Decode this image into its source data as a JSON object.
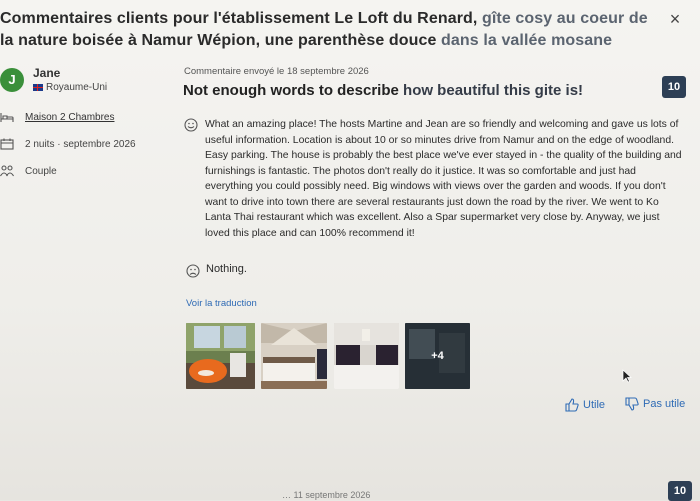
{
  "header": {
    "title_line1_main": "Commentaires clients pour l'établissement Le Loft du Renard,",
    "title_line1_muted": " gîte cosy au coeur de",
    "title_line2_main": "la nature boisée à Namur Wépion, une parenthèse douce",
    "title_line2_muted": " dans la vallée mosane",
    "close_icon": "×"
  },
  "reviewer": {
    "initial": "J",
    "name": "Jane",
    "country": "Royaume-Uni",
    "room": "Maison 2 Chambres",
    "stay": "2 nuits · septembre 2026",
    "traveler_type": "Couple"
  },
  "review": {
    "date": "Commentaire envoyé le 18 septembre 2026",
    "title_main": "Not enough words to describe",
    "title_tail": " how beautiful this gite is!",
    "score": "10",
    "positive": "What an amazing place! The hosts Martine and Jean are so friendly and welcoming and gave us lots of useful information. Location is about 10 or so minutes drive from Namur and on the edge of woodland. Easy parking. The house is probably the best place we've ever stayed in - the quality of the building and furnishings is fantastic. The photos don't really do it justice. It was so comfortable and just had everything you could possibly need. Big windows with views over the garden and woods. If you don't want to drive into town there are several restaurants just down the road by the river. We went to Ko Lanta Thai restaurant which was excellent. Also a Spar supermarket very close by. Anyway, we just loved this place and can 100% recommend it!",
    "negative": "Nothing.",
    "translate_link": "Voir la traduction",
    "more_photos": "+4"
  },
  "actions": {
    "helpful": "Utile",
    "not_helpful": "Pas utile"
  },
  "next_review": {
    "date": "… 11 septembre 2026",
    "score": "10"
  },
  "icons": {
    "close": "close-icon",
    "room": "bed-icon",
    "stay": "calendar-icon",
    "traveler": "group-icon",
    "positive": "smile-icon",
    "negative": "frown-icon",
    "helpful": "thumbs-up-icon",
    "not_helpful": "thumbs-down-icon"
  },
  "colors": {
    "avatar": "#3a8f3a",
    "score_badge": "#2d3f55",
    "link": "#2f6bb5"
  }
}
